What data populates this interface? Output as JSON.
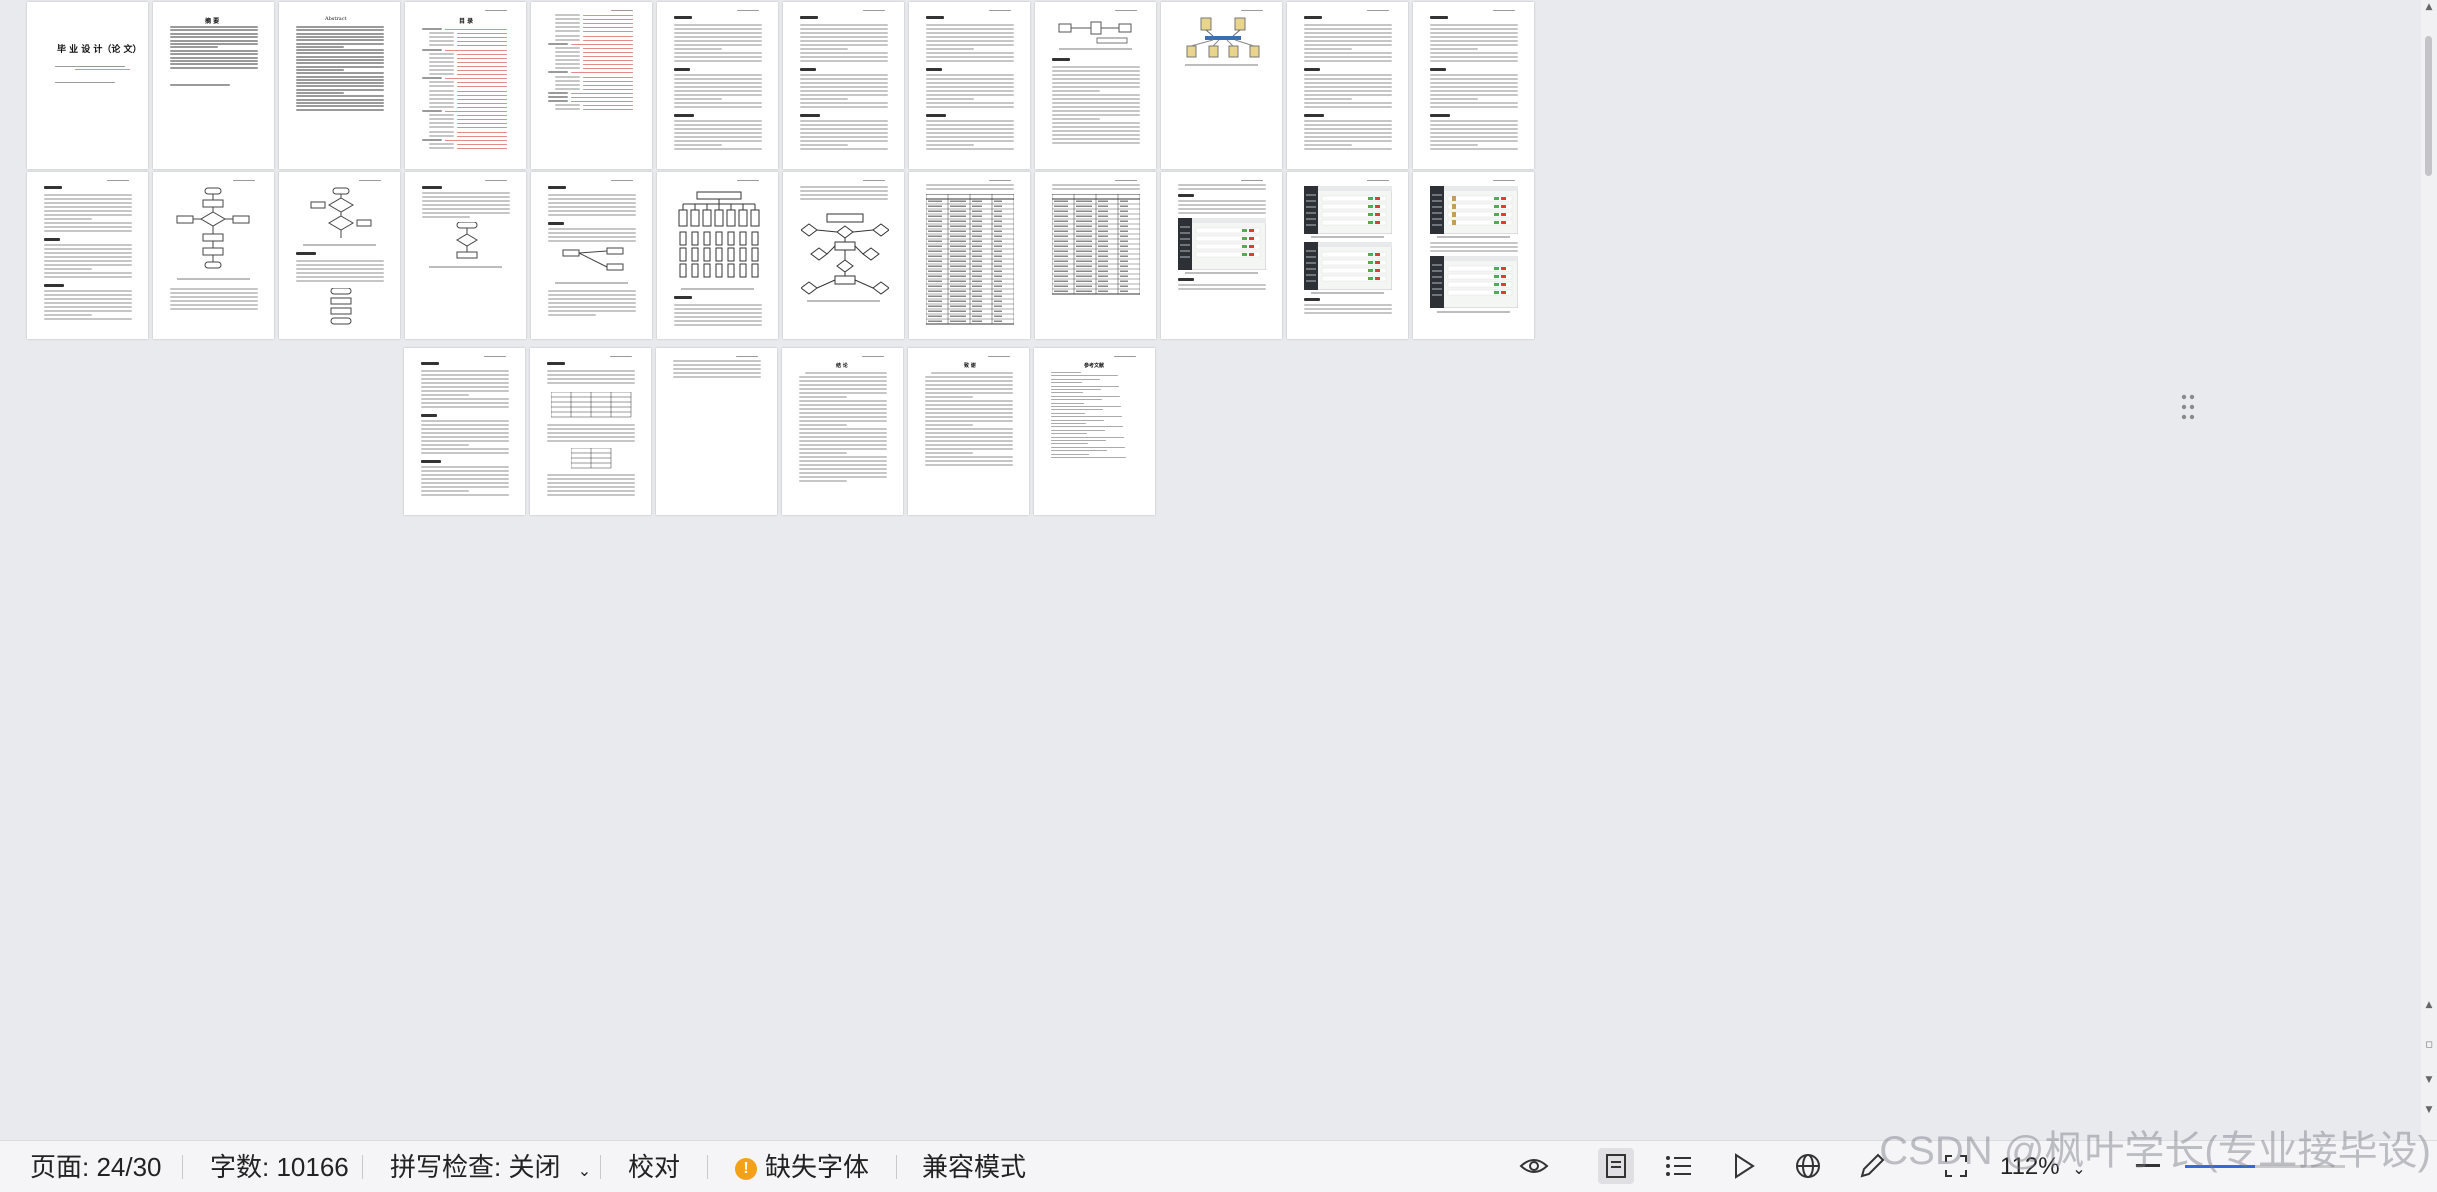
{
  "document": {
    "page_count_visible": 30,
    "title_page": {
      "title": "毕 业 设 计（论 文）"
    },
    "toc_heading": "目 录",
    "abstract_heading": "摘 要",
    "abstract_heading_en": "Abstract",
    "references_heading": "参考文献",
    "conclusion_heading": "结 论",
    "thanks_heading": "致 谢"
  },
  "statusbar": {
    "page_indicator": "页面: 24/30",
    "word_count": "字数: 10166",
    "spellcheck": "拼写检查: 关闭",
    "proofread": "校对",
    "missing_fonts": "缺失字体",
    "compat_mode": "兼容模式",
    "zoom": "112%",
    "icons": [
      "eye-icon",
      "page-view-icon",
      "outline-view-icon",
      "play-icon",
      "web-view-icon",
      "pen-icon",
      "fit-page-icon",
      "zoom-out-icon"
    ],
    "colors": {
      "warning": "#f4a11a",
      "accent": "#2b6fd6"
    }
  },
  "watermark": "CSDN @枫叶学长(专业接毕设)"
}
